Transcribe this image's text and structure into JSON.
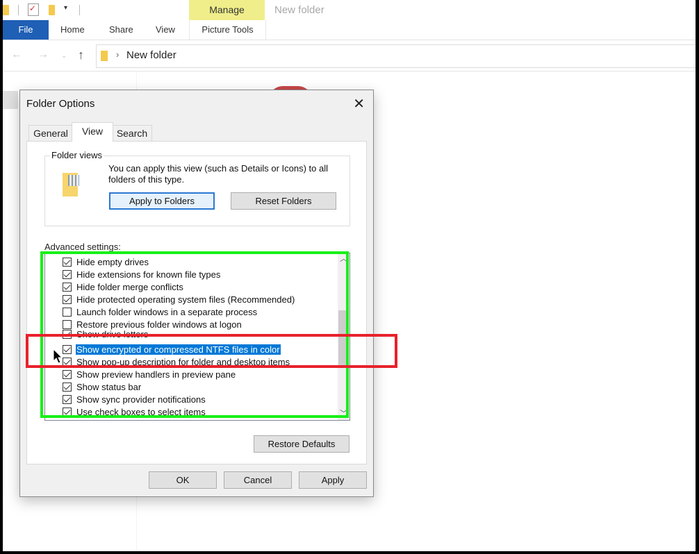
{
  "explorer": {
    "window_title": "New folder",
    "contextual_tab_group": "Manage",
    "ribbon_tabs": [
      "File",
      "Home",
      "Share",
      "View",
      "Picture Tools"
    ],
    "address_path": "New folder"
  },
  "dialog": {
    "title": "Folder Options",
    "tabs": [
      {
        "label": "General",
        "active": false
      },
      {
        "label": "View",
        "active": true
      },
      {
        "label": "Search",
        "active": false
      }
    ],
    "folder_views": {
      "group_label": "Folder views",
      "description": "You can apply this view (such as Details or Icons) to all folders of this type.",
      "apply_button": "Apply to Folders",
      "reset_button": "Reset Folders"
    },
    "advanced": {
      "label": "Advanced settings:",
      "items": [
        {
          "label": "Hide empty drives",
          "checked": true
        },
        {
          "label": "Hide extensions for known file types",
          "checked": true
        },
        {
          "label": "Hide folder merge conflicts",
          "checked": true
        },
        {
          "label": "Hide protected operating system files (Recommended)",
          "checked": true
        },
        {
          "label": "Launch folder windows in a separate process",
          "checked": false
        },
        {
          "label": "Restore previous folder windows at logon",
          "checked": false
        },
        {
          "label": "Show drive letters",
          "checked": true
        },
        {
          "label": "Show encrypted or compressed NTFS files in color",
          "checked": true,
          "selected": true
        },
        {
          "label": "Show pop-up description for folder and desktop items",
          "checked": true
        },
        {
          "label": "Show preview handlers in preview pane",
          "checked": true
        },
        {
          "label": "Show status bar",
          "checked": true
        },
        {
          "label": "Show sync provider notifications",
          "checked": true
        },
        {
          "label": "Use check boxes to select items",
          "checked": true
        }
      ],
      "restore_defaults": "Restore Defaults"
    },
    "buttons": {
      "ok": "OK",
      "cancel": "Cancel",
      "apply": "Apply"
    }
  },
  "annotations": {
    "green_box_color": "#18f018",
    "red_box_color": "#e8222c"
  }
}
